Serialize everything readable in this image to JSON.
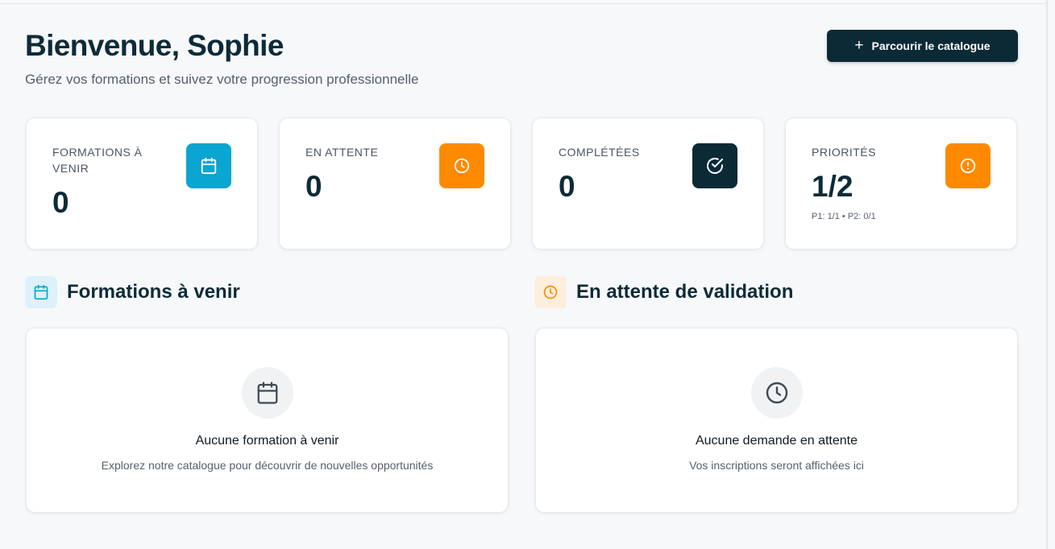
{
  "header": {
    "title": "Bienvenue, Sophie",
    "subtitle": "Gérez vos formations et suivez votre progression professionnelle",
    "catalog_button": {
      "icon": "plus-icon",
      "label": "Parcourir le catalogue"
    }
  },
  "stats": [
    {
      "label": "FORMATIONS À VENIR",
      "value": "0",
      "icon": "calendar-icon",
      "color": "#0aa5d1"
    },
    {
      "label": "EN ATTENTE",
      "value": "0",
      "icon": "clock-icon",
      "color": "#ff8a00"
    },
    {
      "label": "COMPLÉTÉES",
      "value": "0",
      "icon": "check-circle-icon",
      "color": "#0b2a36"
    },
    {
      "label": "PRIORITÉS",
      "value": "1/2",
      "detail": "P1: 1/1 • P2: 0/1",
      "icon": "alert-circle-icon",
      "color": "#ff8a00"
    }
  ],
  "sections": {
    "upcoming": {
      "title": "Formations à venir",
      "icon": "calendar-icon",
      "icon_color": "#0aa5d1",
      "icon_bg": "#dcf1f8",
      "empty_title": "Aucune formation à venir",
      "empty_text": "Explorez notre catalogue pour découvrir de nouvelles opportunités"
    },
    "pending": {
      "title": "En attente de validation",
      "icon": "clock-icon",
      "icon_color": "#ff8a00",
      "icon_bg": "#fdeede",
      "empty_title": "Aucune demande en attente",
      "empty_text": "Vos inscriptions seront affichées ici"
    }
  }
}
